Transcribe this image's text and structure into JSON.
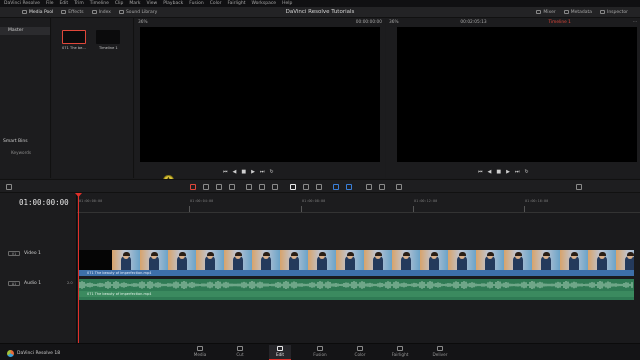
{
  "menu": [
    "DaVinci Resolve",
    "File",
    "Edit",
    "Trim",
    "Timeline",
    "Clip",
    "Mark",
    "View",
    "Playback",
    "Fusion",
    "Color",
    "Fairlight",
    "Workspace",
    "Help"
  ],
  "window_title": "DaVinci Resolve Tutorials",
  "toolbar": {
    "media_pool": "Media Pool",
    "effects": "Effects",
    "edit_index": "Index",
    "sound_library": "Sound Library",
    "mixer": "Mixer",
    "metadata": "Metadata",
    "inspector": "Inspector"
  },
  "bins": {
    "master": "Master",
    "smart_bins": "Smart Bins",
    "keywords": "Keywords"
  },
  "media_pool": {
    "clips": [
      {
        "label": "071 The be..."
      },
      {
        "label": "Timeline 1"
      }
    ]
  },
  "source_viewer": {
    "zoom": "36%",
    "timecode": "00:00:00:00",
    "dropdown": ""
  },
  "timeline_viewer": {
    "zoom": "36%",
    "timecode": "00:02:05:13",
    "timeline_name": "Timeline 1"
  },
  "timeline": {
    "timecode": "01:00:00:00",
    "ruler": [
      "01:00:00:00",
      "01:00:04:00",
      "01:00:08:00",
      "01:00:12:00",
      "01:00:16:00"
    ],
    "video_track": {
      "tag": "V1",
      "name": "Video 1",
      "clip_name": "071 The beauty of imperfection.mp4"
    },
    "audio_track": {
      "tag": "A1",
      "name": "Audio 1",
      "level": "2.0",
      "clip_name": "071 The beauty of imperfection.mp4"
    }
  },
  "footer": {
    "app_name": "DaVinci Resolve 18"
  },
  "pages": [
    "Media",
    "Cut",
    "Edit",
    "Fusion",
    "Color",
    "Fairlight",
    "Deliver"
  ],
  "active_page": "Edit"
}
